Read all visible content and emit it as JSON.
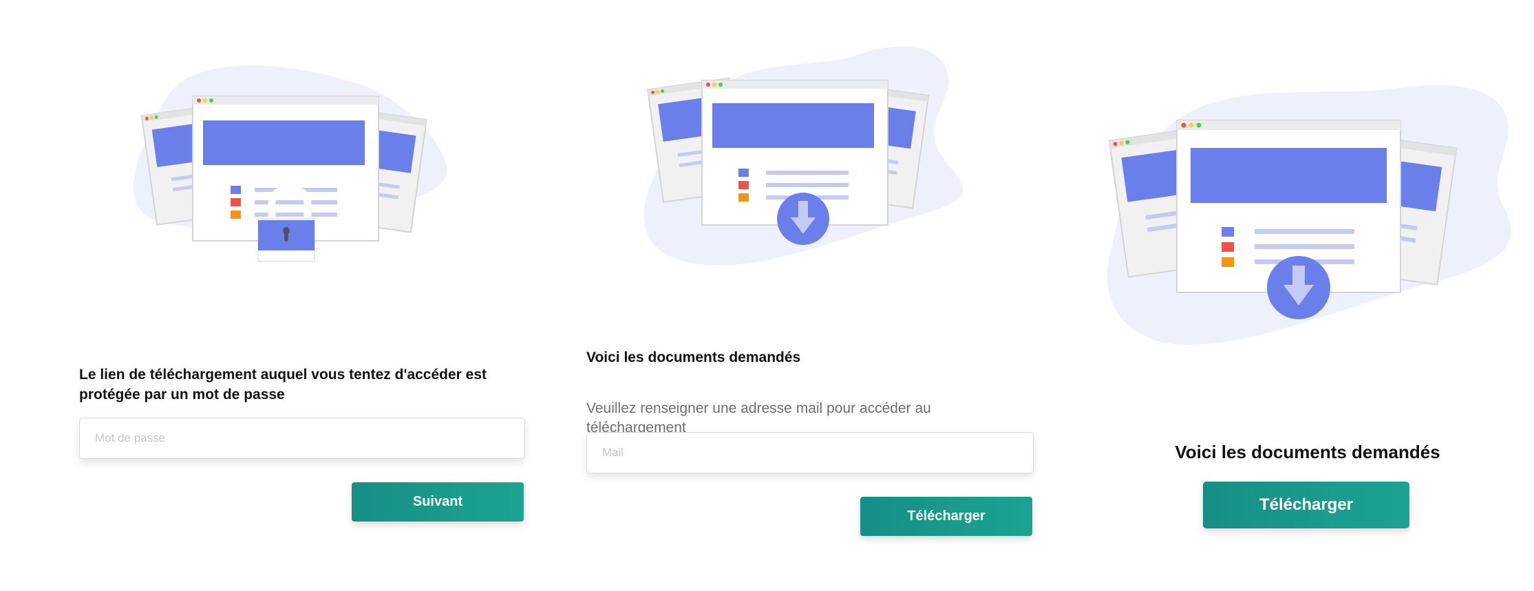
{
  "colors": {
    "accent_start": "#168f86",
    "accent_end": "#1ca392",
    "illustration_primary": "#6b7fea",
    "illustration_light": "#c3caf3",
    "illustration_blob": "#eef0fc",
    "dot_red": "#f2504a",
    "dot_orange": "#f7940f",
    "dot_yellow": "#f6d230",
    "dot_green": "#58c45c"
  },
  "panel_password": {
    "illustration_icon": "lock-icon",
    "title": "Le lien de téléchargement auquel vous tentez d'accéder est protégée par un mot de passe",
    "password_placeholder": "Mot de passe",
    "password_value": "",
    "next_button_label": "Suivant"
  },
  "panel_email": {
    "illustration_icon": "download-arrow-icon",
    "title": "Voici les documents demandés",
    "subtitle": "Veuillez renseigner une adresse mail pour accéder au téléchargement",
    "email_placeholder": "Mail",
    "email_value": "",
    "download_button_label": "Télécharger"
  },
  "panel_download": {
    "illustration_icon": "download-arrow-icon",
    "title": "Voici les documents demandés",
    "download_button_label": "Télécharger"
  }
}
